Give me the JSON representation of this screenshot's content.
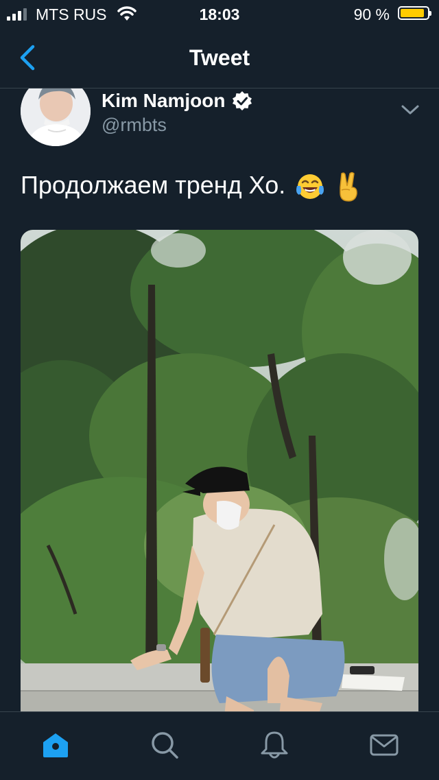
{
  "status_bar": {
    "carrier": "MTS RUS",
    "time": "18:03",
    "battery_percent_text": "90 %",
    "battery_level": 0.9,
    "signal_bars": 3,
    "battery_color": "#ffcc00"
  },
  "nav": {
    "title": "Tweet",
    "accent_color": "#1da1f2"
  },
  "tweet": {
    "author_name": "Kim Namjoon",
    "author_handle": "@rmbts",
    "verified": true,
    "text": "Продолжаем тренд Хо.",
    "emojis": [
      "tears-of-joy-emoji",
      "victory-hand-emoji"
    ]
  },
  "tab_bar": {
    "items": [
      {
        "icon": "home-icon",
        "active": true
      },
      {
        "icon": "search-icon",
        "active": false
      },
      {
        "icon": "bell-icon",
        "active": false
      },
      {
        "icon": "mail-icon",
        "active": false
      }
    ]
  }
}
